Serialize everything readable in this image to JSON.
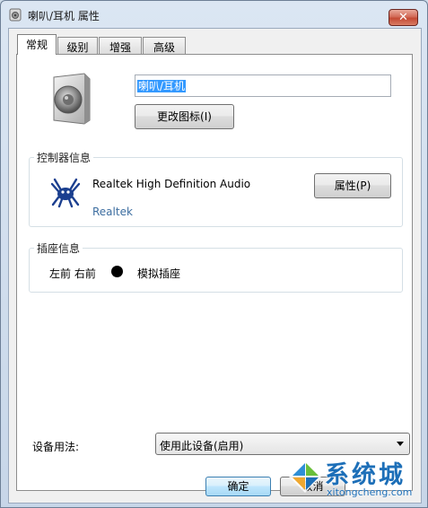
{
  "window": {
    "title": "喇叭/耳机 属性",
    "close_label": "✕"
  },
  "tabs": [
    {
      "label": "常规"
    },
    {
      "label": "级别"
    },
    {
      "label": "增强"
    },
    {
      "label": "高级"
    }
  ],
  "general": {
    "device_name_value": "喇叭/耳机",
    "change_icon_label": "更改图标(I)",
    "controller": {
      "group_label": "控制器信息",
      "name": "Realtek High Definition Audio",
      "vendor": "Realtek",
      "properties_label": "属性(P)"
    },
    "jack": {
      "group_label": "插座信息",
      "position": "左前 右前",
      "type": "模拟插座",
      "color": "#000000"
    },
    "usage": {
      "label": "设备用法:",
      "selected": "使用此设备(启用)"
    }
  },
  "footer": {
    "ok_label": "确定",
    "cancel_label": "取消"
  },
  "watermark": {
    "brand": "系统城",
    "url": "xitongcheng.com"
  },
  "colors": {
    "selection": "#3399ff",
    "vendor_link": "#3d6ea0",
    "close_button": "#c44a34",
    "watermark": "#1d6fb8"
  }
}
